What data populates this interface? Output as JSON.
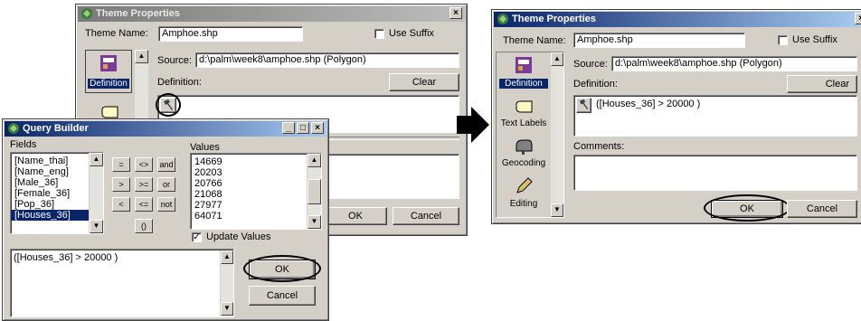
{
  "left_dialog": {
    "title": "Theme Properties",
    "close": "×",
    "theme_name_label": "Theme Name:",
    "theme_name_value": "Amphoe.shp",
    "use_suffix_label": "Use Suffix",
    "source_label": "Source:",
    "source_value": "d:\\palm\\week8\\amphoe.shp (Polygon)",
    "definition_label": "Definition:",
    "clear_button": "Clear",
    "definition_icon_label": "Definition",
    "ok_button": "OK",
    "cancel_button": "Cancel"
  },
  "query_builder": {
    "title": "Query Builder",
    "minimize": "_",
    "maximize": "□",
    "close": "×",
    "fields_label": "Fields",
    "fields": [
      "[Name_thai]",
      "[Name_eng]",
      "[Male_36]",
      "[Female_36]",
      "[Pop_36]",
      "[Houses_36]"
    ],
    "selected_field": "[Houses_36]",
    "operators": [
      "=",
      "<>",
      "and",
      ">",
      ">=",
      "or",
      "<",
      "<=",
      "not",
      "()"
    ],
    "values_label": "Values",
    "values": [
      "14669",
      "20203",
      "20766",
      "21068",
      "27977",
      "64071"
    ],
    "update_values_label": "Update Values",
    "update_values_checked": true,
    "expression": "([Houses_36] > 20000 )",
    "ok_button": "OK",
    "cancel_button": "Cancel"
  },
  "right_dialog": {
    "title": "Theme Properties",
    "close": "×",
    "theme_name_label": "Theme Name:",
    "theme_name_value": "Amphoe.shp",
    "use_suffix_label": "Use Suffix",
    "source_label": "Source:",
    "source_value": "d:\\palm\\week8\\amphoe.shp (Polygon)",
    "definition_label": "Definition:",
    "clear_button": "Clear",
    "definition_value": "([Houses_36] > 20000 )",
    "comments_label": "Comments:",
    "categories": [
      "Definition",
      "Text Labels",
      "Geocoding",
      "Editing"
    ],
    "ok_button": "OK",
    "cancel_button": "Cancel"
  },
  "colors": {
    "active_title": "#0a246a",
    "inactive_title": "#7a7a7a",
    "dialog_face": "#d4d0c8",
    "selection": "#0a246a"
  }
}
